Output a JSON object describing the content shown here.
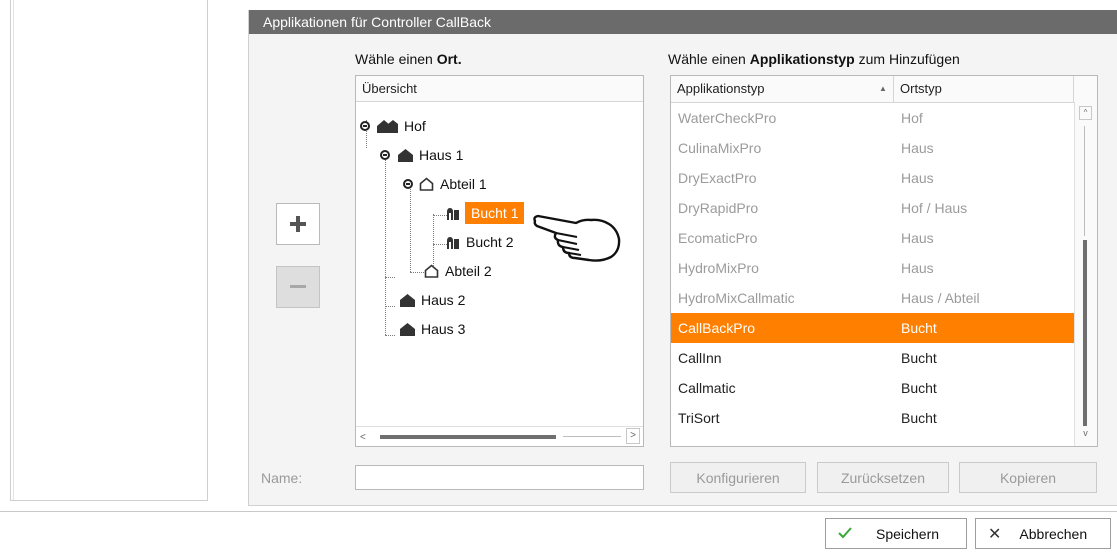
{
  "dialog": {
    "title": "Applikationen für Controller CallBack"
  },
  "location": {
    "prompt_prefix": "Wähle einen ",
    "prompt_bold": "Ort.",
    "tree_header": "Übersicht",
    "nodes": [
      {
        "label": "Hof",
        "icon": "farm-icon"
      },
      {
        "label": "Haus 1",
        "icon": "house-icon"
      },
      {
        "label": "Abteil 1",
        "icon": "compartment-icon"
      },
      {
        "label": "Bucht 1",
        "icon": "pen-icon",
        "selected": true
      },
      {
        "label": "Bucht 2",
        "icon": "pen-icon"
      },
      {
        "label": "Abteil 2",
        "icon": "compartment-icon"
      },
      {
        "label": "Haus 2",
        "icon": "house-icon"
      },
      {
        "label": "Haus 3",
        "icon": "house-icon"
      }
    ]
  },
  "apptype": {
    "prompt_prefix": "Wähle einen ",
    "prompt_bold": "Applikationstyp",
    "prompt_suffix": " zum Hinzufügen",
    "columns": [
      "Applikationstyp",
      "Ortstyp"
    ],
    "sort_indicator": "▲",
    "rows": [
      {
        "name": "WaterCheckPro",
        "loc": "Hof",
        "state": "disabled"
      },
      {
        "name": "CulinaMixPro",
        "loc": "Haus",
        "state": "disabled"
      },
      {
        "name": "DryExactPro",
        "loc": "Haus",
        "state": "disabled"
      },
      {
        "name": "DryRapidPro",
        "loc": "Hof / Haus",
        "state": "disabled"
      },
      {
        "name": "EcomaticPro",
        "loc": "Haus",
        "state": "disabled"
      },
      {
        "name": "HydroMixPro",
        "loc": "Haus",
        "state": "disabled"
      },
      {
        "name": "HydroMixCallmatic",
        "loc": "Haus / Abteil",
        "state": "disabled"
      },
      {
        "name": "CallBackPro",
        "loc": "Bucht",
        "state": "selected"
      },
      {
        "name": "CallInn",
        "loc": "Bucht",
        "state": "enabled"
      },
      {
        "name": "Callmatic",
        "loc": "Bucht",
        "state": "enabled"
      },
      {
        "name": "TriSort",
        "loc": "Bucht",
        "state": "enabled"
      }
    ]
  },
  "tools": {
    "add_icon": "plus-icon",
    "remove_icon": "minus-icon"
  },
  "name_field": {
    "label": "Name:",
    "value": ""
  },
  "actions": {
    "configure": "Konfigurieren",
    "reset": "Zurücksetzen",
    "copy": "Kopieren"
  },
  "footer": {
    "save": "Speichern",
    "cancel": "Abbrechen"
  },
  "colors": {
    "accent": "#ff7f00",
    "header": "#6b6b6b",
    "disabled_text": "#9b9b9b",
    "save_check": "#3aa73a"
  }
}
